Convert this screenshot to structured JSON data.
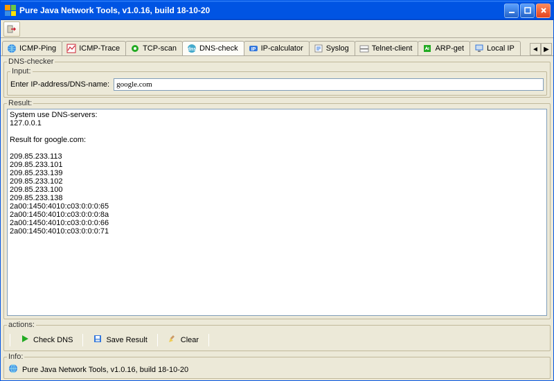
{
  "window": {
    "title": "Pure Java Network Tools,  v1.0.16, build 18-10-20"
  },
  "tabs": [
    {
      "id": "icmp-ping",
      "label": "ICMP-Ping"
    },
    {
      "id": "icmp-trace",
      "label": "ICMP-Trace"
    },
    {
      "id": "tcp-scan",
      "label": "TCP-scan"
    },
    {
      "id": "dns-check",
      "label": "DNS-check"
    },
    {
      "id": "ip-calculator",
      "label": "IP-calculator"
    },
    {
      "id": "syslog",
      "label": "Syslog"
    },
    {
      "id": "telnet-client",
      "label": "Telnet-client"
    },
    {
      "id": "arp-get",
      "label": "ARP-get"
    },
    {
      "id": "local-ip",
      "label": "Local IP"
    }
  ],
  "active_tab": "dns-check",
  "panel": {
    "title": "DNS-checker",
    "input_group_label": "Input:",
    "input_label": "Enter IP-address/DNS-name:",
    "input_value": "google.com",
    "result_group_label": "Result:",
    "result_text": "System use DNS-servers:\n127.0.0.1\n\nResult for google.com:\n\n209.85.233.113\n209.85.233.101\n209.85.233.139\n209.85.233.102\n209.85.233.100\n209.85.233.138\n2a00:1450:4010:c03:0:0:0:65\n2a00:1450:4010:c03:0:0:0:8a\n2a00:1450:4010:c03:0:0:0:66\n2a00:1450:4010:c03:0:0:0:71",
    "actions_group_label": "actions:",
    "actions": {
      "check": "Check DNS",
      "save": "Save Result",
      "clear": "Clear"
    }
  },
  "info": {
    "group_label": "Info:",
    "text": "Pure Java Network Tools,  v1.0.16, build 18-10-20"
  }
}
